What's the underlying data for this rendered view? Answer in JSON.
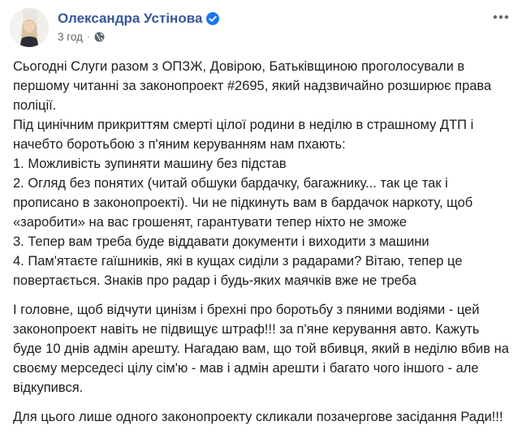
{
  "post": {
    "author": "Олександра Устінова",
    "time": "3 год",
    "separator": "·",
    "paragraphs": [
      "Сьогодні Слуги разом з ОПЗЖ, Довірою, Батьківщиною проголосували в першому читанні за законопроект #2695, який надзвичайно розширює права поліції.\nПід цинічним прикриттям смерті цілої родини в неділю в страшному ДТП і начебто боротьбою з п'яним керуванням нам пхають:\n1. Можливість зупиняти машину без підстав\n2. Огляд без понятих (читай обшуки бардачку, багажнику... так це так і прописано в законопроекті). Чи не підкинуть вам в бардачок наркоту, щоб «заробити» на вас грошенят, гарантувати тепер ніхто не зможе\n3. Тепер вам треба буде віддавати документи і виходити з машини\n4. Пам'ятаєте гаїшників, які в кущах сиділи з радарами? Вітаю, тепер це повертається. Знаків про радар і будь-яких маячків вже не треба",
      "І головне, щоб відчути цинізм і брехні про боротьбу з пяними водіями - цей законопроект навіть не підвищує штраф!!! за п'яне керування авто. Кажуть буде 10 днів адмін арешту. Нагадаю вам, що той вбивця, який в неділю вбив на своєму мерседесі цілу сім'ю - мав і адмін арешти і багато чого іншого - але відкупився.",
      "Для цього лише одного законопроекту скликали позачергове засідання Ради!!!"
    ]
  },
  "icons": {
    "verified": "verified-badge-icon",
    "audience": "globe-icon",
    "more": "more-options-icon"
  },
  "colors": {
    "author": "#385898",
    "text": "#1c1e21",
    "meta": "#606770",
    "verified": "#1877f2"
  }
}
